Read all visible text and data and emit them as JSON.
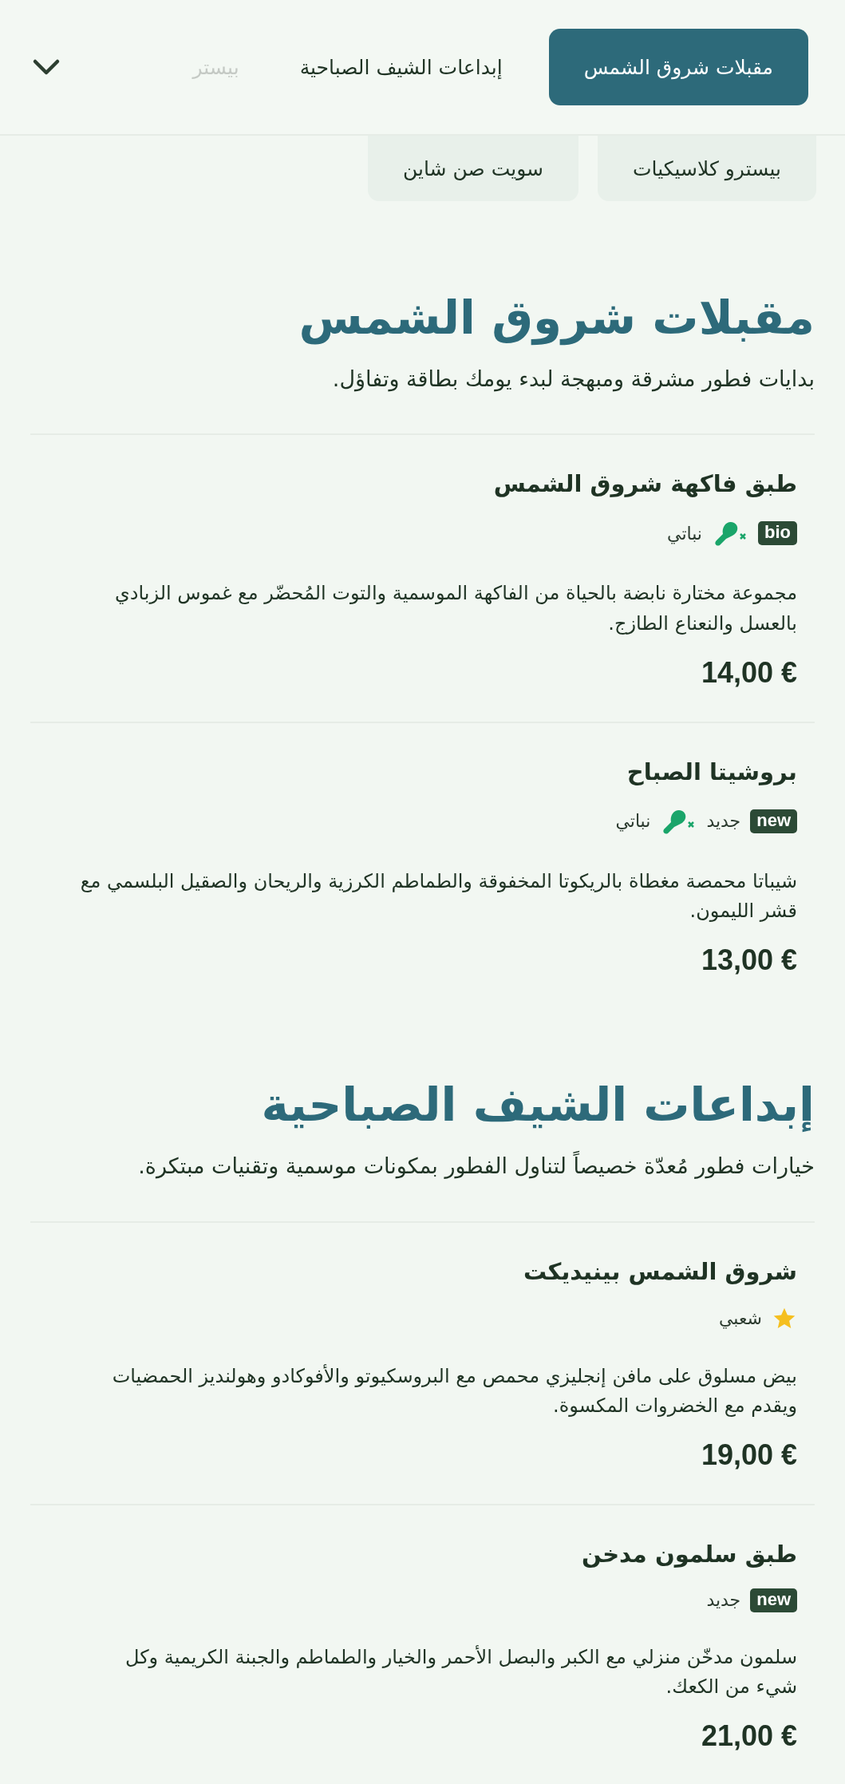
{
  "nav": {
    "tabs": [
      {
        "label": "مقبلات شروق الشمس",
        "selected": true
      },
      {
        "label": "إبداعات الشيف الصباحية",
        "selected": false
      },
      {
        "label": "بيستر",
        "selected": false,
        "faded": true
      }
    ],
    "chips": [
      {
        "label": "بيسترو كلاسيكيات",
        "selected": false
      },
      {
        "label": "سويت صن شاين",
        "selected": false
      }
    ]
  },
  "sections": [
    {
      "title": "مقبلات شروق الشمس",
      "subtitle": "بدايات فطور مشرقة ومبهجة لبدء يومك بطاقة وتفاؤل.",
      "items": [
        {
          "name": "طبق فاكهة شروق الشمس",
          "tags": [
            {
              "kind": "badge",
              "label": "bio"
            },
            {
              "kind": "vegan",
              "label": "نباتي"
            }
          ],
          "description": "مجموعة مختارة نابضة بالحياة من الفاكهة الموسمية والتوت المُحضّر مع غموس الزبادي بالعسل والنعناع الطازج.",
          "price": "14,00 €"
        },
        {
          "name": "بروشيتا الصباح",
          "tags": [
            {
              "kind": "badge",
              "label": "new"
            },
            {
              "kind": "text",
              "label": "جديد"
            },
            {
              "kind": "vegan",
              "label": "نباتي"
            }
          ],
          "description": "شيباتا محمصة مغطاة بالريكوتا المخفوقة والطماطم الكرزية والريحان والصقيل البلسمي مع قشر الليمون.",
          "price": "13,00 €"
        }
      ]
    },
    {
      "title": "إبداعات الشيف الصباحية",
      "subtitle": "خيارات فطور مُعدّة خصيصاً لتناول الفطور بمكونات موسمية وتقنيات مبتكرة.",
      "items": [
        {
          "name": "شروق الشمس بينيديكت",
          "tags": [
            {
              "kind": "popular",
              "label": "شعبي"
            }
          ],
          "description": "بيض مسلوق على مافن إنجليزي محمص مع البروسكيوتو والأفوكادو وهولنديز الحمضيات ويقدم مع الخضروات المكسوة.",
          "price": "19,00 €"
        },
        {
          "name": "طبق سلمون مدخن",
          "tags": [
            {
              "kind": "badge",
              "label": "new"
            },
            {
              "kind": "text",
              "label": "جديد"
            }
          ],
          "description": "سلمون مدخّن منزلي مع الكبر والبصل الأحمر والخيار والطماطم والجبنة الكريمية وكل شيء من الكعك.",
          "price": "21,00 €"
        }
      ]
    }
  ]
}
